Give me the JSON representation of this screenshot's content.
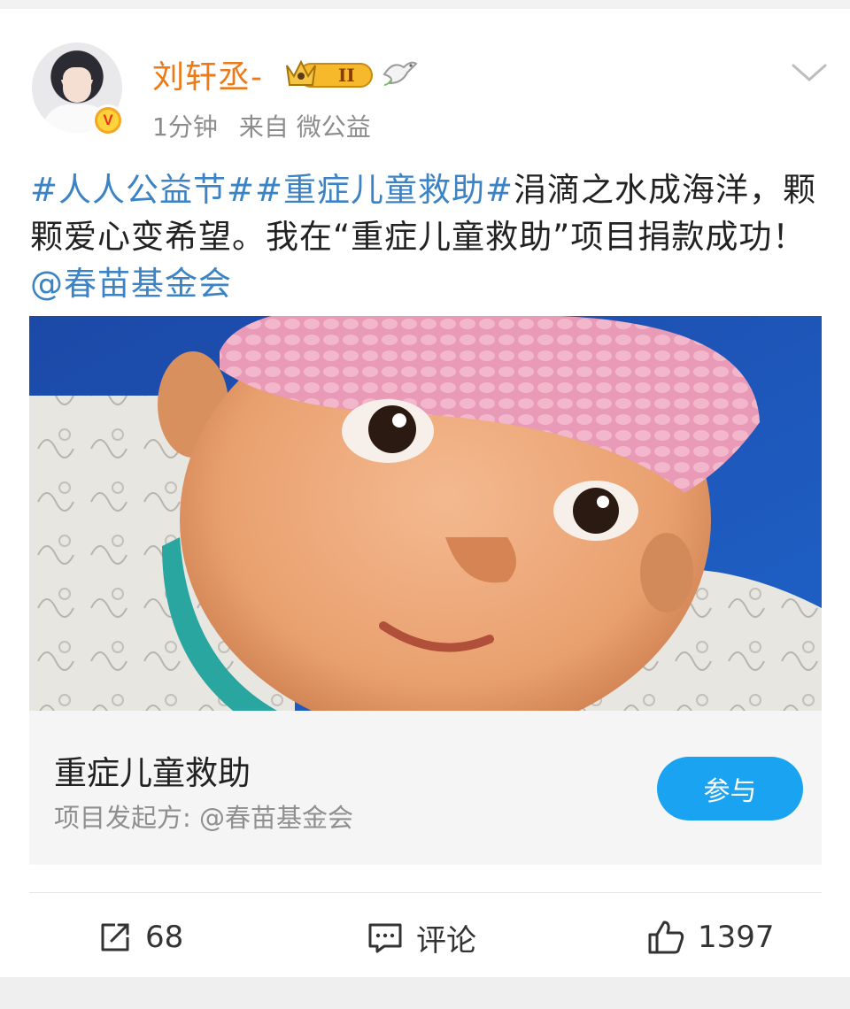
{
  "post": {
    "author": {
      "name": "刘轩丞-",
      "crown_level": "II",
      "verified_badge": "V",
      "icons": [
        "crown-icon",
        "dove-icon",
        "verified-v-icon"
      ]
    },
    "time": "1分钟",
    "source": "来自 微公益",
    "text": {
      "tag1": "#人人公益节#",
      "tag2": "#重症儿童救助#",
      "body": "涓滴之水成海洋，颗颗爱心变希望。我在“重症儿童救助”项目捐款成功！",
      "mention": "@春苗基金会"
    },
    "project": {
      "title": "重症儿童救助",
      "organizer": "项目发起方: @春苗基金会",
      "join_label": "参与"
    },
    "actions": {
      "share_count": "68",
      "comment_label": "评论",
      "like_count": "1397"
    }
  },
  "colors": {
    "username": "#ec7a18",
    "link": "#3b83c4",
    "button": "#1aa3f0",
    "meta": "#8c8c8c"
  }
}
